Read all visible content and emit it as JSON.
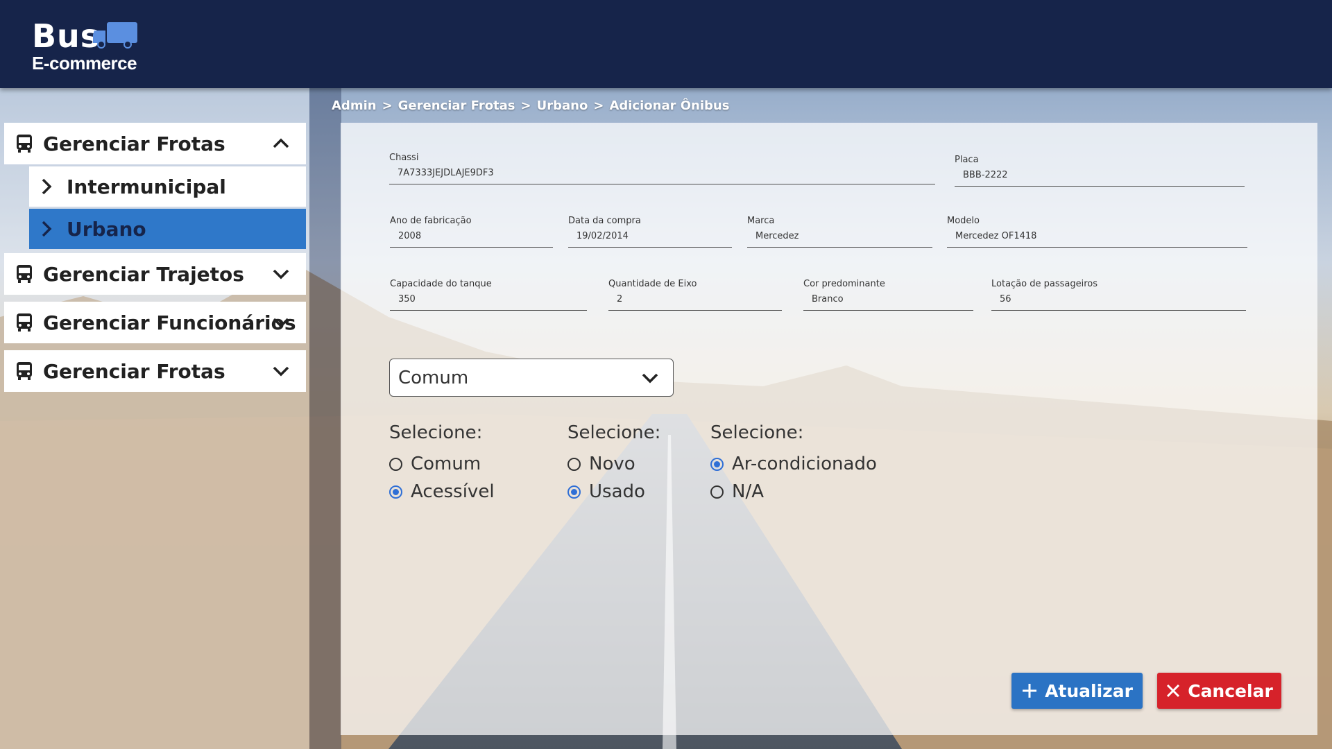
{
  "brand": {
    "name": "Bus",
    "subtitle": "E-commerce"
  },
  "breadcrumb": [
    "Admin",
    ">",
    "Gerenciar Frotas",
    ">",
    "Urbano",
    ">",
    "Adicionar Ônibus"
  ],
  "sidebar": {
    "groups": [
      {
        "label": "Gerenciar Frotas",
        "expanded": true,
        "icon": "bus-icon",
        "items": [
          {
            "label": "Intermunicipal",
            "active": false
          },
          {
            "label": "Urbano",
            "active": true
          }
        ]
      },
      {
        "label": "Gerenciar Trajetos",
        "expanded": false,
        "icon": "bus-icon"
      },
      {
        "label": "Gerenciar Funcionários",
        "expanded": false,
        "icon": "bus-icon"
      },
      {
        "label": "Gerenciar Frotas",
        "expanded": false,
        "icon": "bus-icon"
      }
    ]
  },
  "form": {
    "chassi": {
      "label": "Chassi",
      "value": "7A7333JEJDLAJE9DF3"
    },
    "placa": {
      "label": "Placa",
      "value": "BBB-2222"
    },
    "ano": {
      "label": "Ano de fabricação",
      "value": "2008"
    },
    "data_compra": {
      "label": "Data da compra",
      "value": "19/02/2014"
    },
    "marca": {
      "label": "Marca",
      "value": "Mercedez"
    },
    "modelo": {
      "label": "Modelo",
      "value": "Mercedez OF1418"
    },
    "tanque": {
      "label": "Capacidade do tanque",
      "value": "350"
    },
    "eixo": {
      "label": "Quantidade de Eixo",
      "value": "2"
    },
    "cor": {
      "label": "Cor predominante",
      "value": "Branco"
    },
    "lotacao": {
      "label": "Lotação de passageiros",
      "value": "56"
    },
    "tipo_select": {
      "value": "Comum"
    },
    "radio_groups": [
      {
        "title": "Selecione:",
        "options": [
          {
            "label": "Comum",
            "checked": false
          },
          {
            "label": "Acessível",
            "checked": true
          }
        ]
      },
      {
        "title": "Selecione:",
        "options": [
          {
            "label": "Novo",
            "checked": false
          },
          {
            "label": "Usado",
            "checked": true
          }
        ]
      },
      {
        "title": "Selecione:",
        "options": [
          {
            "label": "Ar-condicionado",
            "checked": true
          },
          {
            "label": "N/A",
            "checked": false
          }
        ]
      }
    ]
  },
  "buttons": {
    "update": "Atualizar",
    "cancel": "Cancelar"
  },
  "colors": {
    "header": "#16244a",
    "accent": "#2b73c4",
    "danger": "#d6222a",
    "active_nav": "#2f78c9"
  }
}
